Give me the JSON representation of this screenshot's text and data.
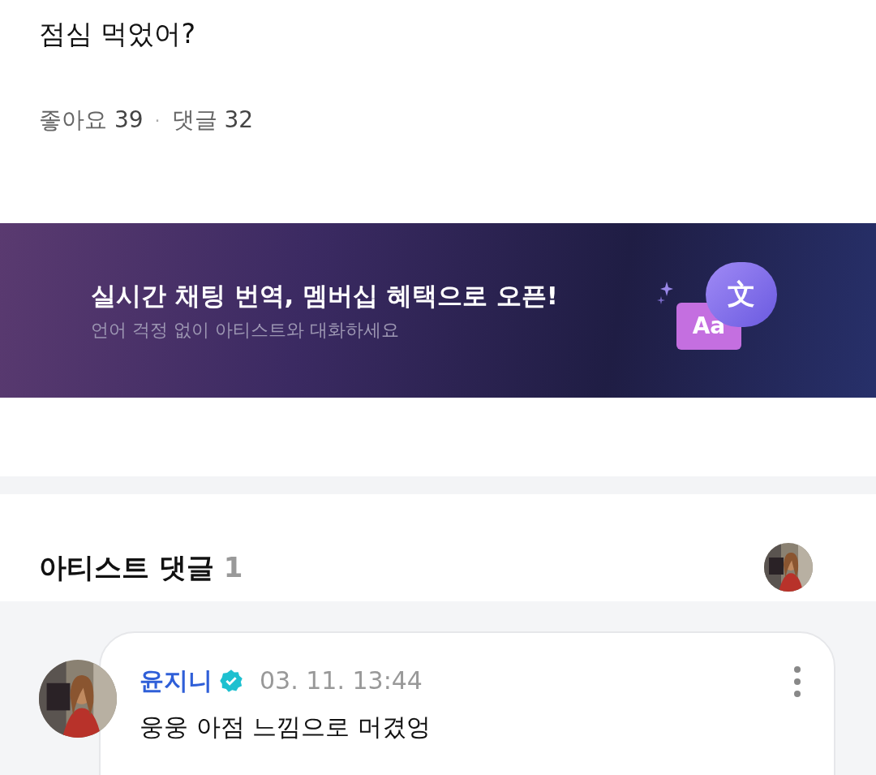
{
  "post": {
    "text": "점심 먹었어?",
    "likes_label": "좋아요",
    "likes": "39",
    "separator": "·",
    "comments_label": "댓글",
    "comments": "32"
  },
  "banner": {
    "title": "실시간 채팅 번역, 멤버십 혜택으로 오픈!",
    "subtitle": "언어 걱정 없이 아티스트와 대화하세요",
    "bubble_back": "Aa",
    "bubble_front": "文"
  },
  "artist_comments": {
    "title": "아티스트 댓글",
    "count": "1",
    "comments": [
      {
        "author": "윤지니",
        "verified": true,
        "time": "03. 11. 13:44",
        "text": "웅웅 아점 느낌으로 머겼엉"
      }
    ]
  }
}
